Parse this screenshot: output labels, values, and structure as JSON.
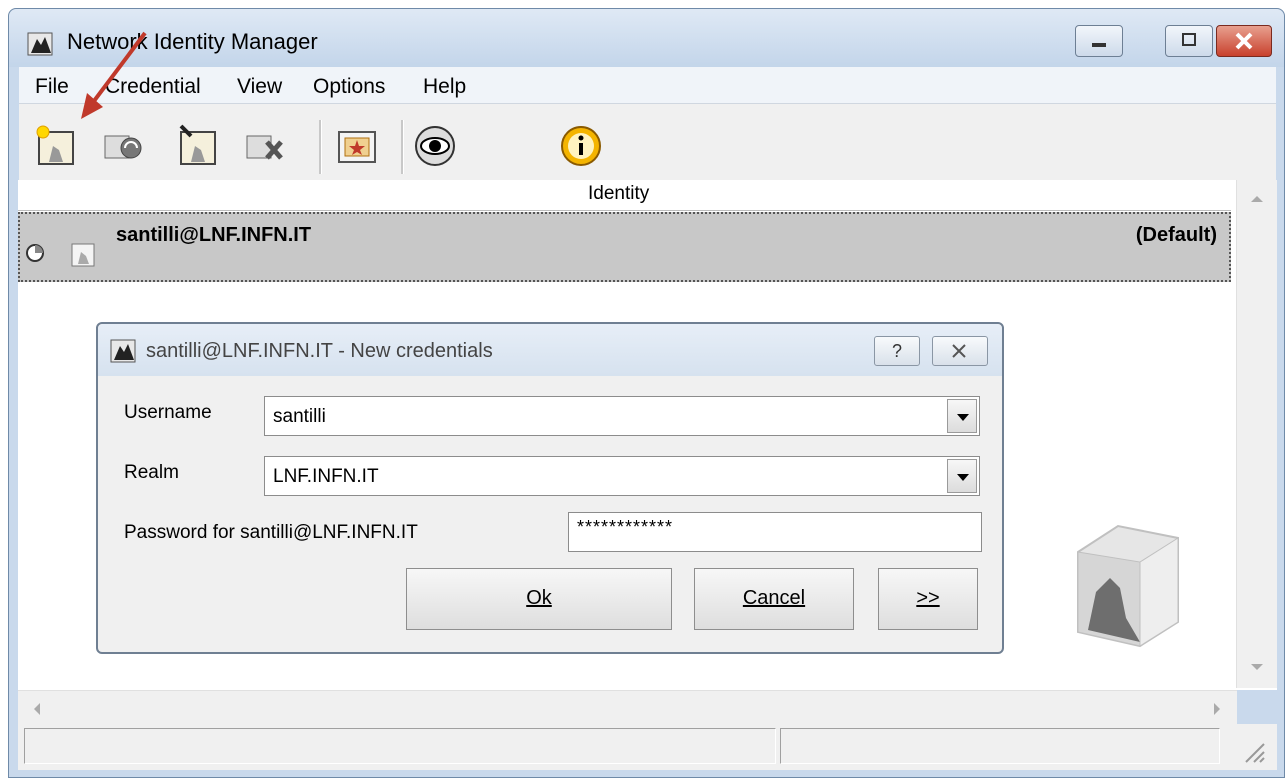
{
  "window": {
    "title": "Network Identity Manager"
  },
  "menu": [
    "File",
    "Credential",
    "View",
    "Options",
    "Help"
  ],
  "toolbar": {
    "icons": [
      "new-credentials-icon",
      "renew-credentials-icon",
      "import-credentials-icon",
      "destroy-credentials-icon",
      "passwords-icon",
      "view-icon",
      "about-icon"
    ]
  },
  "list": {
    "column_header": "Identity",
    "rows": [
      {
        "name": "santilli@LNF.INFN.IT",
        "status": "(Default)"
      }
    ]
  },
  "dialog": {
    "title": "santilli@LNF.INFN.IT - New credentials",
    "help_label": "?",
    "username_label": "Username",
    "username_value": "santilli",
    "realm_label": "Realm",
    "realm_value": "LNF.INFN.IT",
    "password_label": "Password for santilli@LNF.INFN.IT",
    "password_value": "************",
    "ok_label": "Ok",
    "cancel_label": "Cancel",
    "more_label": ">>"
  },
  "colors": {
    "arrow": "#c0392b",
    "selection": "#c8c8c8",
    "titlebar": "#c3d5ea"
  }
}
